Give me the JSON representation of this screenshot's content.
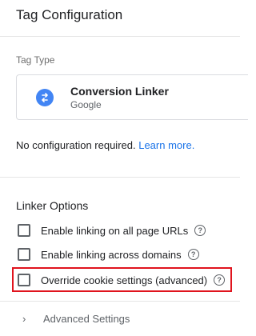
{
  "header": {
    "title": "Tag Configuration"
  },
  "tag_type": {
    "section_label": "Tag Type",
    "name": "Conversion Linker",
    "vendor": "Google",
    "icon": "conversion-linker-icon",
    "icon_color": "#4285f4"
  },
  "config_note": {
    "text": "No configuration required.",
    "link": "Learn more."
  },
  "linker_options": {
    "title": "Linker Options",
    "items": [
      {
        "label": "Enable linking on all page URLs",
        "checked": false
      },
      {
        "label": "Enable linking across domains",
        "checked": false
      },
      {
        "label": "Override cookie settings (advanced)",
        "checked": false,
        "highlighted": true
      }
    ],
    "help_glyph": "?"
  },
  "advanced": {
    "label": "Advanced Settings",
    "chevron": "›"
  },
  "colors": {
    "link": "#1a73e8",
    "highlight": "#e0141e"
  }
}
